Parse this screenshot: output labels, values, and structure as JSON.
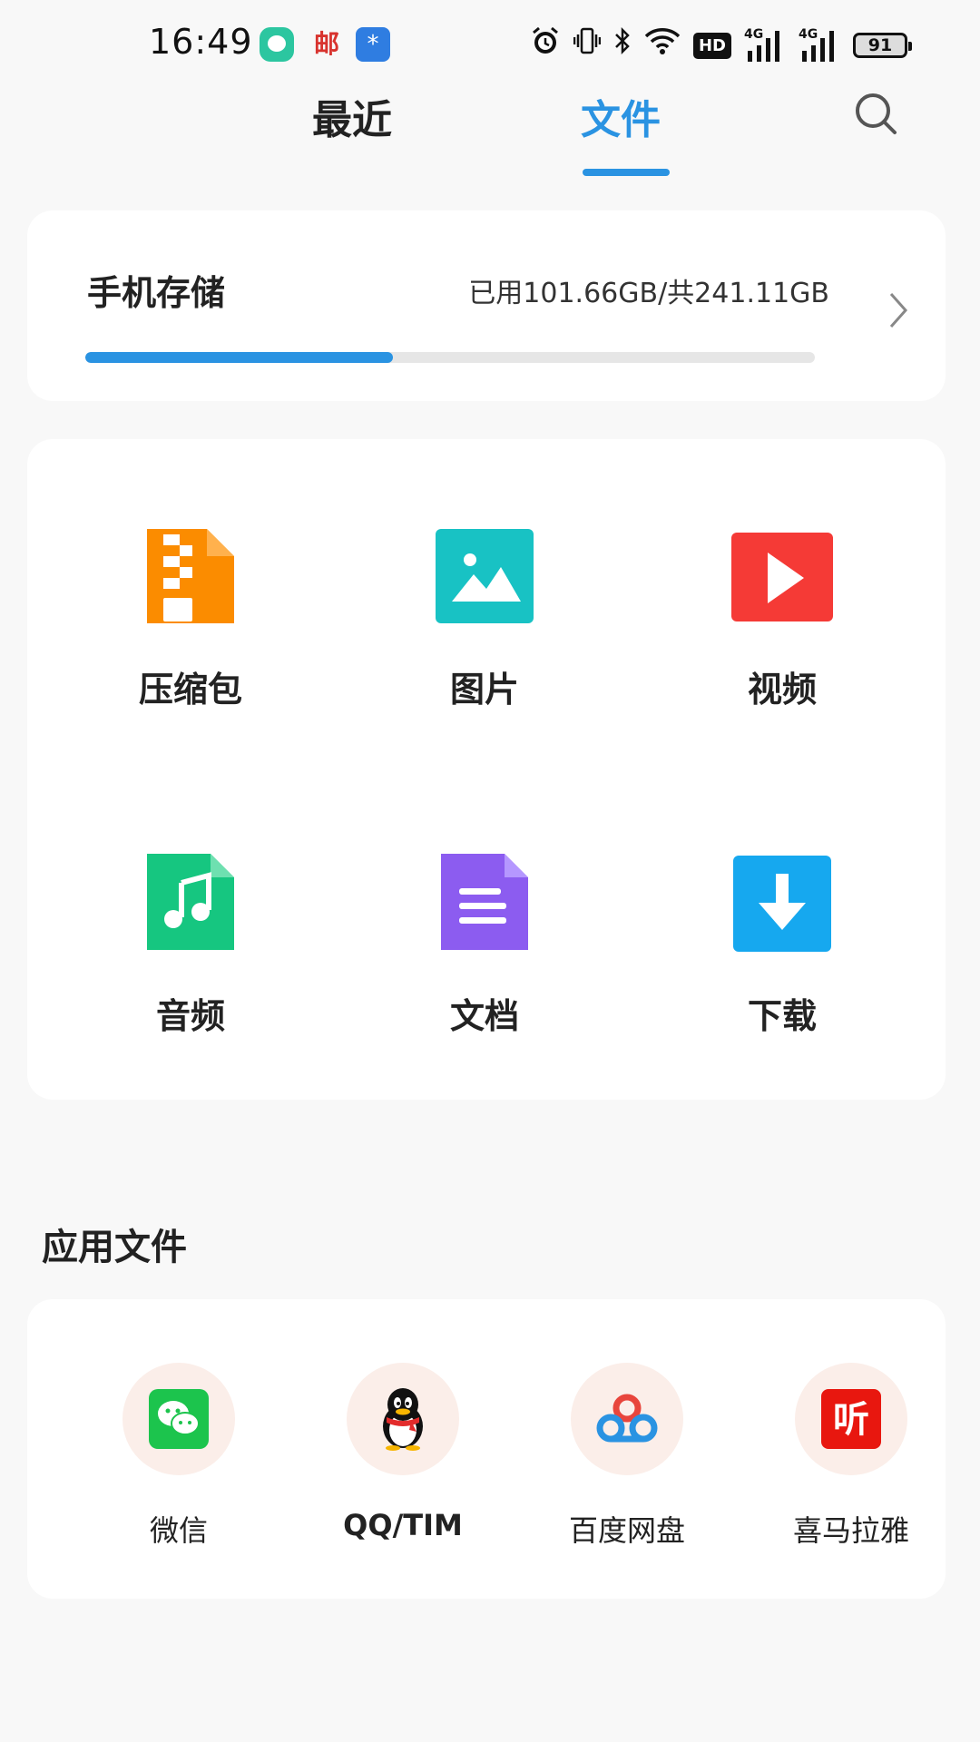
{
  "status_bar": {
    "time": "16:49",
    "notif_mail_glyph": "邮",
    "notif_star_glyph": "*",
    "hd_badge": "HD",
    "signal_label": "4G",
    "battery": "91"
  },
  "tabs": {
    "recent": "最近",
    "files": "文件",
    "active": "files"
  },
  "storage": {
    "title": "手机存储",
    "usage": "已用101.66GB/共241.11GB",
    "used_fraction": 0.4216
  },
  "categories": [
    {
      "label": "压缩包",
      "icon": "archive-icon"
    },
    {
      "label": "图片",
      "icon": "image-icon"
    },
    {
      "label": "视频",
      "icon": "video-icon"
    },
    {
      "label": "音频",
      "icon": "audio-icon"
    },
    {
      "label": "文档",
      "icon": "document-icon"
    },
    {
      "label": "下载",
      "icon": "download-icon"
    }
  ],
  "apps_section": {
    "title": "应用文件",
    "apps": [
      {
        "label": "微信",
        "icon": "wechat-icon"
      },
      {
        "label": "QQ/TIM",
        "icon": "qq-icon"
      },
      {
        "label": "百度网盘",
        "icon": "baidu-netdisk-icon"
      },
      {
        "label": "喜马拉雅",
        "icon": "ximalaya-icon"
      }
    ],
    "ximalaya_glyph": "听"
  },
  "colors": {
    "accent": "#2a93e2",
    "archive": "#fb8c00",
    "image": "#18c2c4",
    "video": "#f53a36",
    "audio": "#16c680",
    "document": "#8c5cf0",
    "download": "#16a8ef"
  }
}
